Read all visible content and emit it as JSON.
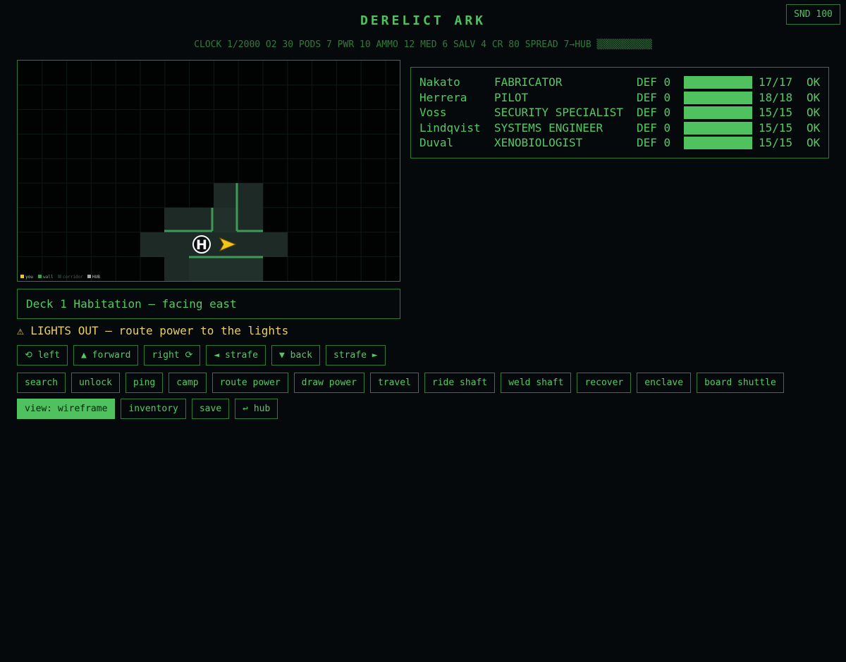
{
  "title": "DERELICT ARK",
  "sound_button": "SND 100",
  "status_line": "CLOCK 1/2000 O2 30 PODS 7 PWR 10 AMMO 12 MED 6 SALV 4 CR 80 SPREAD 7→HUB ▒▒▒▒▒▒▒▒▒▒",
  "map": {
    "legend": [
      "you",
      "wall",
      "corridor",
      "HUB"
    ],
    "hub_marker": "H",
    "colors": {
      "you": "#f5c518",
      "wall": "#3f9a58",
      "corridor": "#1d2a26",
      "grid": "#0e1a14"
    }
  },
  "location": "Deck 1 Habitation — facing east",
  "alert": "⚠ LIGHTS OUT — route power to the lights",
  "movement": [
    "⟲ left",
    "▲ forward",
    "right ⟳",
    "◄ strafe",
    "▼ back",
    "strafe ►"
  ],
  "actions": [
    "search",
    "unlock",
    "ping",
    "camp",
    "route power",
    "draw power",
    "travel",
    "ride shaft",
    "weld shaft",
    "recover",
    "enclave",
    "board shuttle"
  ],
  "system": [
    {
      "label": "view: wireframe",
      "active": true
    },
    {
      "label": "inventory",
      "active": false
    },
    {
      "label": "save",
      "active": false
    },
    {
      "label": "↩ hub",
      "active": false
    }
  ],
  "crew": [
    {
      "name": "Nakato",
      "role": "FABRICATOR",
      "def": "DEF 0",
      "hp": "17/17",
      "hp_fraction": 1.0,
      "state": "OK"
    },
    {
      "name": "Herrera",
      "role": "PILOT",
      "def": "DEF 0",
      "hp": "18/18",
      "hp_fraction": 1.0,
      "state": "OK"
    },
    {
      "name": "Voss",
      "role": "SECURITY SPECIALIST",
      "def": "DEF 0",
      "hp": "15/15",
      "hp_fraction": 1.0,
      "state": "OK"
    },
    {
      "name": "Lindqvist",
      "role": "SYSTEMS ENGINEER",
      "def": "DEF 0",
      "hp": "15/15",
      "hp_fraction": 1.0,
      "state": "OK"
    },
    {
      "name": "Duval",
      "role": "XENOBIOLOGIST",
      "def": "DEF 0",
      "hp": "15/15",
      "hp_fraction": 1.0,
      "state": "OK"
    }
  ]
}
